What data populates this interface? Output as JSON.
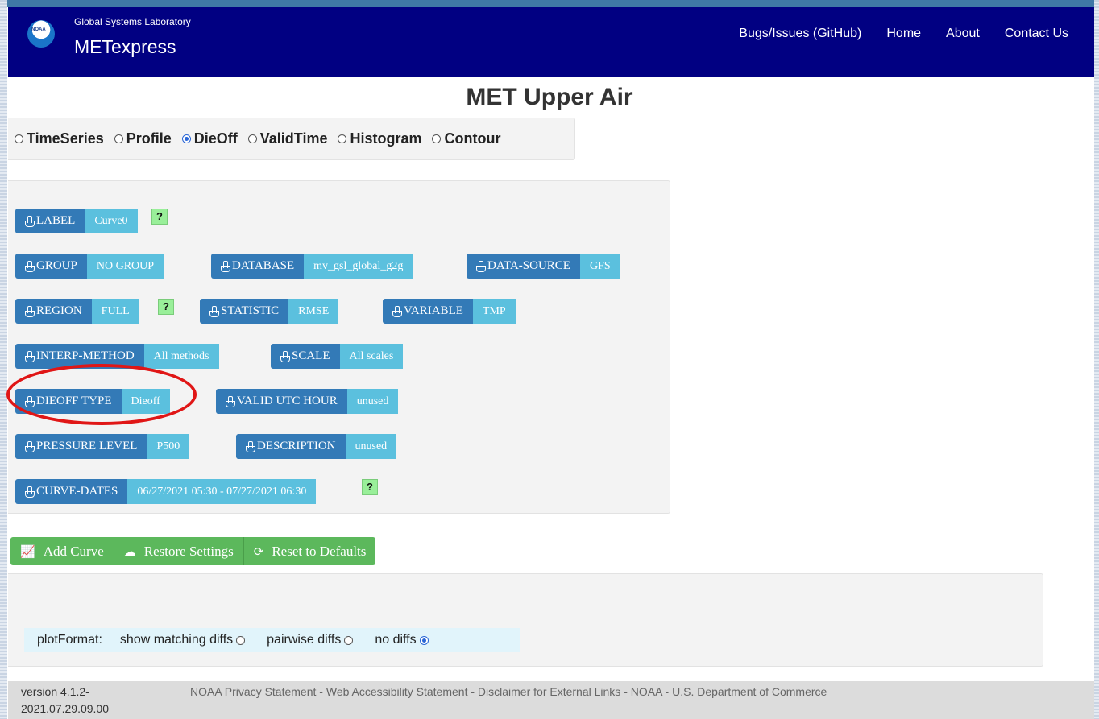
{
  "navbar": {
    "logo_text": "NOAA",
    "org": "Global Systems Laboratory",
    "app": "METexpress",
    "links": [
      "Bugs/Issues (GitHub)",
      "Home",
      "About",
      "Contact Us"
    ]
  },
  "page_title": "MET Upper Air",
  "plot_types": [
    {
      "label": "TimeSeries",
      "selected": false
    },
    {
      "label": "Profile",
      "selected": false
    },
    {
      "label": "DieOff",
      "selected": true
    },
    {
      "label": "ValidTime",
      "selected": false
    },
    {
      "label": "Histogram",
      "selected": false
    },
    {
      "label": "Contour",
      "selected": false
    }
  ],
  "params": {
    "label": {
      "name": "LABEL",
      "value": "Curve0"
    },
    "group": {
      "name": "GROUP",
      "value": "NO GROUP"
    },
    "database": {
      "name": "DATABASE",
      "value": "mv_gsl_global_g2g"
    },
    "data_source": {
      "name": "DATA-SOURCE",
      "value": "GFS"
    },
    "region": {
      "name": "REGION",
      "value": "FULL"
    },
    "statistic": {
      "name": "STATISTIC",
      "value": "RMSE"
    },
    "variable": {
      "name": "VARIABLE",
      "value": "TMP"
    },
    "interp_method": {
      "name": "INTERP-METHOD",
      "value": "All methods"
    },
    "scale": {
      "name": "SCALE",
      "value": "All scales"
    },
    "dieoff_type": {
      "name": "DIEOFF TYPE",
      "value": "Dieoff"
    },
    "valid_utc_hour": {
      "name": "VALID UTC HOUR",
      "value": "unused"
    },
    "pressure_level": {
      "name": "PRESSURE LEVEL",
      "value": "P500"
    },
    "description": {
      "name": "DESCRIPTION",
      "value": "unused"
    },
    "curve_dates": {
      "name": "CURVE-DATES",
      "value": "06/27/2021 05:30 - 07/27/2021 06:30"
    }
  },
  "help_glyph": "?",
  "actions": {
    "add_curve": "Add Curve",
    "restore": "Restore Settings",
    "reset": "Reset to Defaults"
  },
  "plot_format": {
    "label": "plotFormat:",
    "options": [
      {
        "label": "show matching diffs",
        "selected": false
      },
      {
        "label": "pairwise diffs",
        "selected": false
      },
      {
        "label": "no diffs",
        "selected": true
      }
    ]
  },
  "footer": {
    "version_line1": "version 4.1.2-",
    "version_line2": "2021.07.29.09.00",
    "links": [
      "NOAA Privacy Statement",
      "Web Accessibility Statement",
      "Disclaimer for External Links",
      "NOAA",
      "U.S. Department of Commerce"
    ],
    "separator": " - "
  },
  "colors": {
    "navbar": "#010082",
    "param_label": "#337ab7",
    "param_value": "#5bc0de",
    "action_button": "#5cb85c",
    "highlight_circle": "#e01616"
  }
}
